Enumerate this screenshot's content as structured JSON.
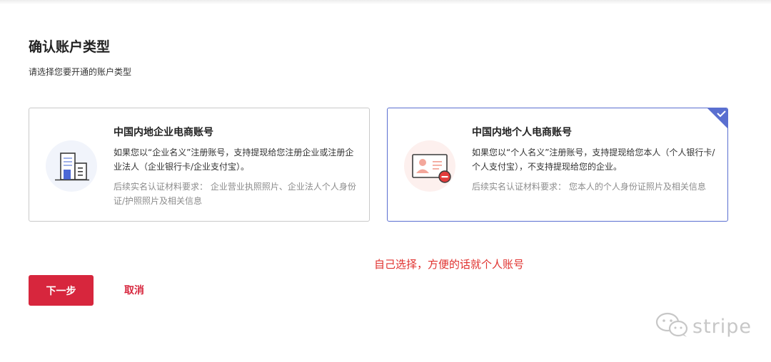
{
  "header": {
    "title": "确认账户类型",
    "subtitle": "请选择您要开通的账户类型"
  },
  "cards": [
    {
      "title": "中国内地企业电商账号",
      "description": "如果您以“企业名义”注册账号，支持提现给您注册企业或注册企业法人（企业银行卡/企业支付宝）。",
      "requirements": "后续实名认证材料要求：  企业营业执照照片、企业法人个人身份证/护照照片及相关信息",
      "selected": false,
      "icon": "building-icon"
    },
    {
      "title": "中国内地个人电商账号",
      "description": "如果您以“个人名义”注册账号，支持提现给您本人（个人银行卡/个人支付宝），不支持提现给您的企业。",
      "requirements": "后续实名认证材料要求：  您本人的个人身份证照片及相关信息",
      "selected": true,
      "icon": "id-card-icon"
    }
  ],
  "annotation": "自己选择，方便的话就个人账号",
  "actions": {
    "next_label": "下一步",
    "cancel_label": "取消"
  },
  "watermark": {
    "text": "stripe",
    "icon": "wechat-icon"
  },
  "colors": {
    "accent_red": "#d7263d",
    "annotation_red": "#e0312e",
    "selected_border": "#5a6fd0",
    "card_border": "#c9c9c9",
    "muted_text": "#8c8c8c"
  }
}
